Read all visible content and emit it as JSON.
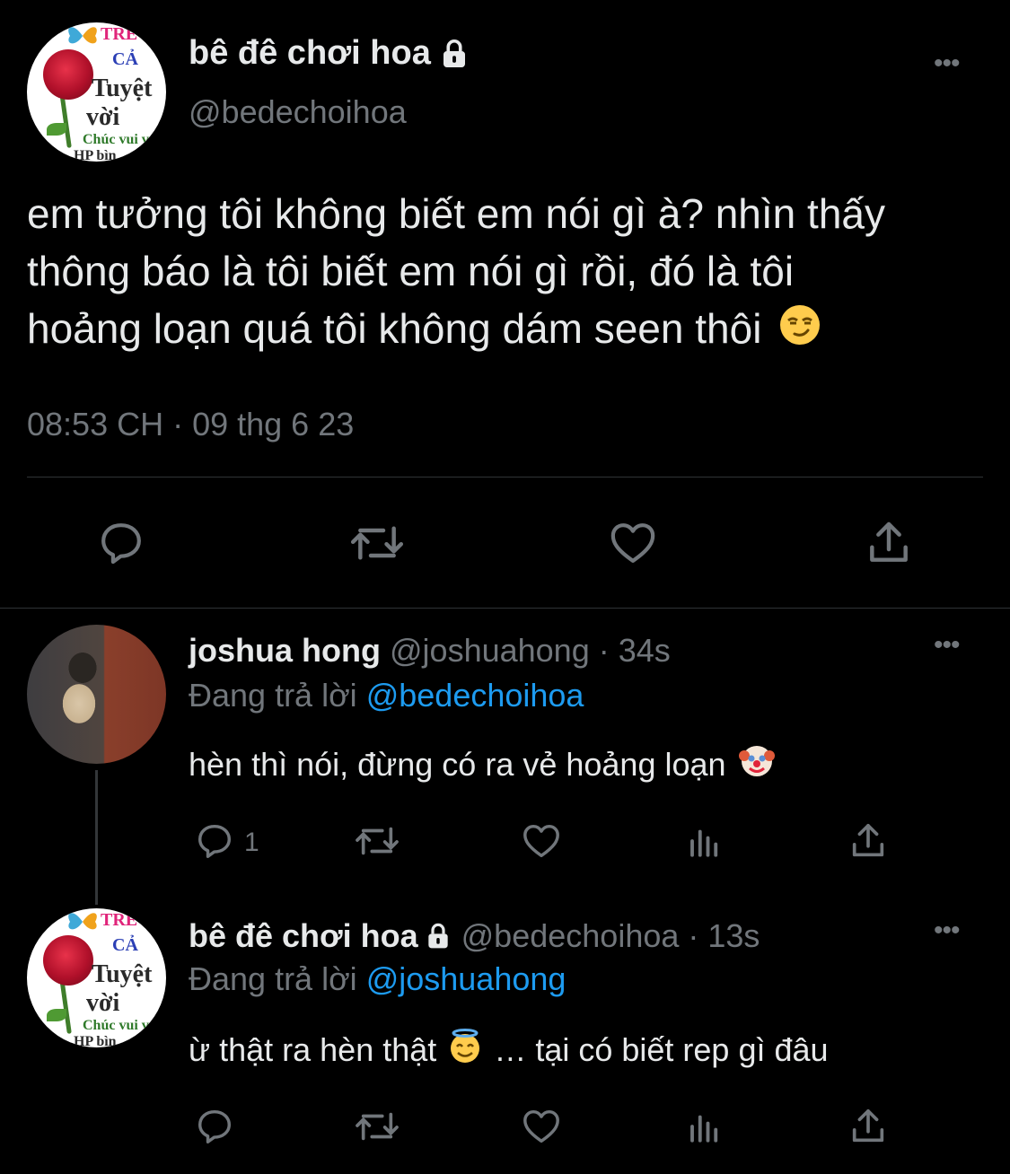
{
  "main_tweet": {
    "display_name": "bê đê chơi hoa",
    "handle": "@bedechoihoa",
    "avatar_text": {
      "line1": "TRE",
      "line2": "CẢ",
      "line3": "Tuyệt",
      "line4": "vời",
      "line5": "Chúc vui v",
      "line6": "HP bìn"
    },
    "text_lines": [
      "em tưởng tôi không biết em nói gì à? nhìn thấy",
      "thông báo là tôi biết em nói gì rồi, đó là tôi",
      "hoảng loạn quá tôi không dám seen thôi"
    ],
    "emoji": "smirking-face",
    "timestamp": "08:53 CH · 09 thg 6 23",
    "actions": [
      "reply-icon",
      "retweet-icon",
      "like-icon",
      "share-icon"
    ]
  },
  "replies": [
    {
      "display_name": "joshua hong",
      "handle": "@joshuahong",
      "time": "· 34s",
      "replying_prefix": "Đang trả lời",
      "replying_to": "@bedechoihoa",
      "text": "hèn thì nói, đừng có ra vẻ hoảng loạn",
      "emoji": "clown-face",
      "reply_count": "1"
    },
    {
      "display_name": "bê đê chơi hoa",
      "handle": "@bedechoihoa",
      "time": "· 13s",
      "replying_prefix": "Đang trả lời",
      "replying_to": "@joshuahong",
      "text_before": "ừ thật ra hèn thật",
      "text_after": "… tại có biết rep gì đâu",
      "emoji": "smiling-face-with-halo",
      "reply_count": ""
    }
  ],
  "colors": {
    "background": "#000000",
    "text": "#e7e9ea",
    "muted": "#71767b",
    "link": "#1d9bf0",
    "divider": "#2f3336"
  }
}
